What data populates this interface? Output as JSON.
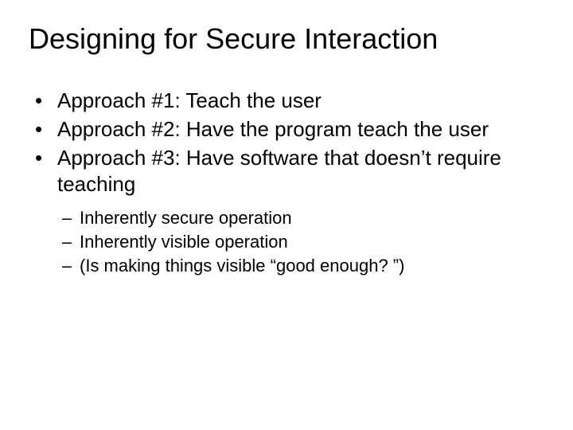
{
  "title": "Designing for Secure Interaction",
  "bullets": [
    "Approach #1: Teach the user",
    "Approach #2: Have the program teach the user",
    "Approach #3: Have software that doesn’t require teaching"
  ],
  "sub_bullets": [
    "Inherently secure operation",
    "Inherently visible operation",
    "(Is making things visible “good enough? ”)"
  ]
}
